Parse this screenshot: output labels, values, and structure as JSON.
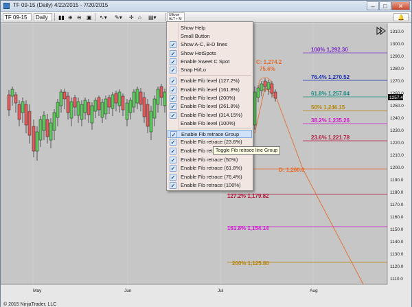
{
  "window": {
    "title": "TF 09-15 (Daily)  4/22/2015 - 7/20/2015",
    "minimize": "–",
    "maximize": "□",
    "close": "✕"
  },
  "toolbar": {
    "instrument": "TF 09-15",
    "interval": "Daily",
    "tool_small": "Ultivue",
    "tool_small_sub": "ALT + M"
  },
  "chart": {
    "copyright": "© 2015 NinjaTrader, LLC",
    "x_labels": [
      "May",
      "Jun",
      "Jul",
      "Aug"
    ],
    "y_labels": [
      "1310.0",
      "1300.0",
      "1290.0",
      "1280.0",
      "1270.0",
      "1260.0",
      "1250.0",
      "1240.0",
      "1230.0",
      "1220.0",
      "1210.0",
      "1200.0",
      "1190.0",
      "1180.0",
      "1170.0",
      "1160.0",
      "1150.0",
      "1140.0",
      "1130.0",
      "1120.0",
      "1110.0"
    ],
    "current_price": "1257.4",
    "point_c": "C: 1,274.2",
    "point_c_pct": "75.6%",
    "point_d": "D: 1,200.0",
    "fib_levels": [
      {
        "label": "100% 1,292.30",
        "color": "#7a2fc4"
      },
      {
        "label": "76.4% 1,270.52",
        "color": "#1a2fb3"
      },
      {
        "label": "61.8% 1,257.04",
        "color": "#138a7e"
      },
      {
        "label": "50% 1,246.15",
        "color": "#b8860b"
      },
      {
        "label": "38.2% 1,235.26",
        "color": "#d214d2"
      },
      {
        "label": "23.6% 1,221.78",
        "color": "#b3163c"
      },
      {
        "label": "127.2% 1,179.82",
        "color": "#b3163c"
      },
      {
        "label": "161.8% 1,154.14",
        "color": "#d214d2"
      },
      {
        "label": "200% 1,125.80",
        "color": "#b8860b"
      }
    ]
  },
  "menu": {
    "items": [
      {
        "label": "Show Help",
        "checked": false
      },
      {
        "label": "Small Button",
        "checked": false
      },
      {
        "label": "Show A-C, B-D lines",
        "checked": true
      },
      {
        "label": "Show HotSpots",
        "checked": true
      },
      {
        "label": "Enable Sweet C Spot",
        "checked": true
      },
      {
        "label": "Snap Hi/Lo",
        "checked": true
      },
      {
        "label": "Enable Fib level (127.2%)",
        "checked": true
      },
      {
        "label": "Enable Fib level (161.8%)",
        "checked": true
      },
      {
        "label": "Enable Fib level (200%)",
        "checked": true
      },
      {
        "label": "Enable Fib level (261.8%)",
        "checked": true
      },
      {
        "label": "Enable Fib level (314.15%)",
        "checked": true
      },
      {
        "label": "Enable Fib level (100%)",
        "checked": false
      },
      {
        "label": "Enable Fib retrace Group",
        "checked": true
      },
      {
        "label": "Enable Fib retrace (23.6%)",
        "checked": true
      },
      {
        "label": "Enable Fib retrace (38.2%)",
        "checked": true
      },
      {
        "label": "Enable Fib retrace (50%)",
        "checked": true
      },
      {
        "label": "Enable Fib retrace (61.8%)",
        "checked": true
      },
      {
        "label": "Enable Fib retrace (76.4%)",
        "checked": true
      },
      {
        "label": "Enable Fib retrace (100%)",
        "checked": true
      }
    ],
    "highlighted": "Enable Fib retrace Group",
    "check_glyph": "✓"
  },
  "tooltip": "Toggle Fib retrace line Group"
}
